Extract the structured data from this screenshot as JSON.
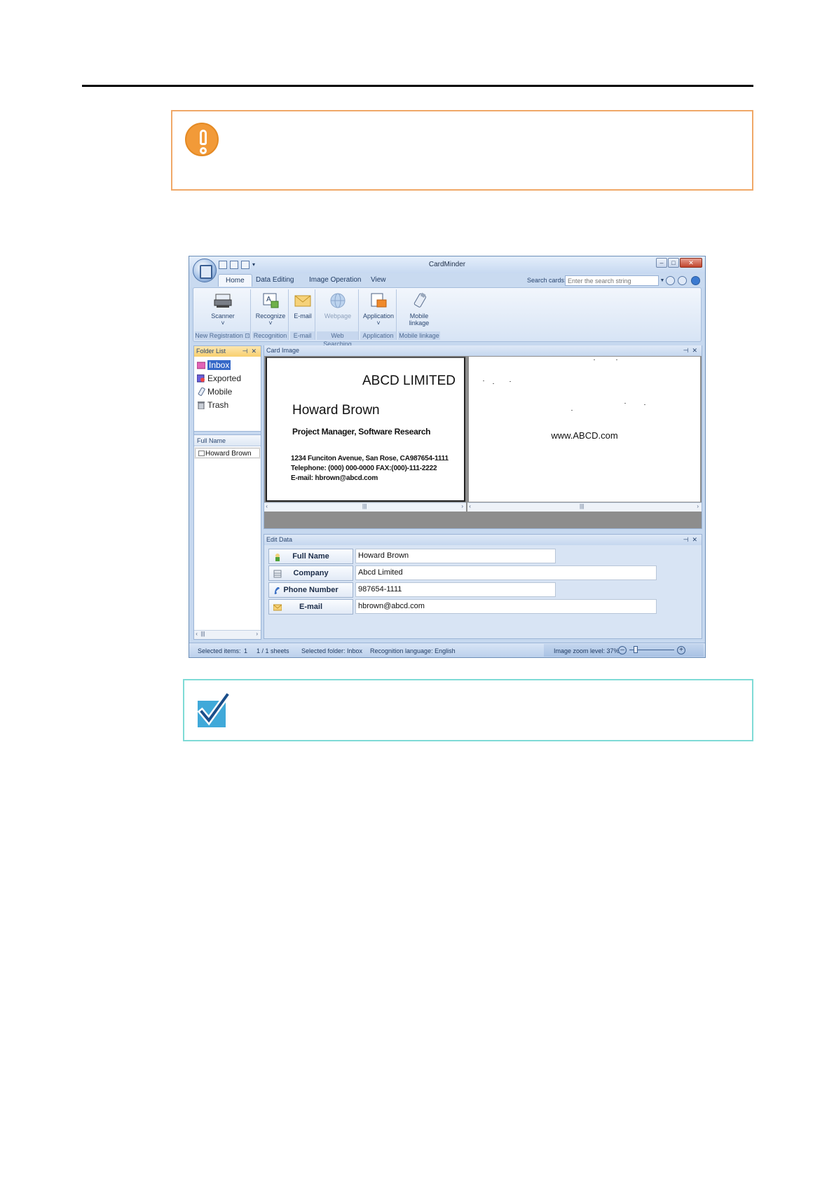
{
  "window": {
    "title": "CardMinder",
    "tabs": [
      "Home",
      "Data Editing",
      "Image Operation",
      "View"
    ],
    "search_label": "Search cards:",
    "search_placeholder": "Enter the search string"
  },
  "ribbon": {
    "buttons": {
      "scanner": "Scanner",
      "recognize": "Recognize",
      "email": "E-mail",
      "webpage": "Webpage",
      "application": "Application",
      "mobile_line1": "Mobile",
      "mobile_line2": "linkage"
    },
    "groups": {
      "new_registration": "New Registration",
      "recognition": "Recognition",
      "email": "E-mail",
      "web_searching": "Web Searching",
      "application": "Application",
      "mobile_linkage": "Mobile linkage"
    }
  },
  "folder_list": {
    "title": "Folder List",
    "items": [
      "Inbox",
      "Exported",
      "Mobile",
      "Trash"
    ]
  },
  "name_list": {
    "header": "Full Name",
    "rows": [
      "Howard Brown"
    ]
  },
  "card_image": {
    "title": "Card Image",
    "front": {
      "company": "ABCD LIMITED",
      "name": "Howard Brown",
      "job_title": "Project Manager, Software Research",
      "address": "1234 Funciton Avenue, San Rose, CA987654-1111",
      "phone_fax": "Telephone: (000) 000-0000  FAX:(000)-111-2222",
      "email": "E-mail: hbrown@abcd.com"
    },
    "back": {
      "website": "www.ABCD.com"
    }
  },
  "edit_data": {
    "title": "Edit Data",
    "fields": [
      {
        "label": "Full Name",
        "value": "Howard Brown"
      },
      {
        "label": "Company",
        "value": "Abcd Limited"
      },
      {
        "label": "Phone Number",
        "value": "987654-1111"
      },
      {
        "label": "E-mail",
        "value": "hbrown@abcd.com"
      }
    ]
  },
  "status": {
    "selected_items_label": "Selected items:",
    "selected_items_value": "1",
    "sheets": "1 /    1 sheets",
    "selected_folder": "Selected folder: Inbox",
    "recognition_language": "Recognition language: English",
    "zoom": "Image zoom level:  37%"
  },
  "colors": {
    "caution_border": "#f0a868",
    "caution_icon": "#f29a38",
    "hint_border": "#7fdbd6",
    "hint_icon": "#40a9d9"
  },
  "icons": {
    "caution": "exclamation-icon",
    "hint": "checkmark-icon"
  }
}
